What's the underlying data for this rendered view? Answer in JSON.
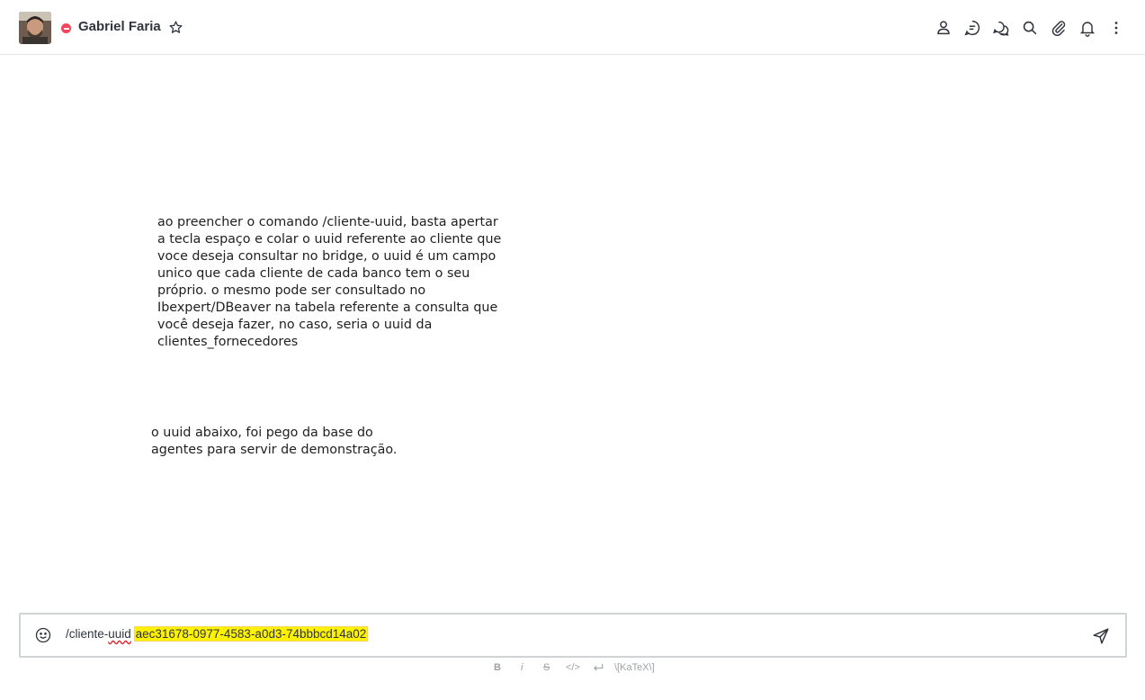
{
  "header": {
    "user_name": "Gabriel Faria",
    "status_color": "#f5455c",
    "toolbar_icons": [
      "user-icon",
      "discussion-icon",
      "threads-icon",
      "search-icon",
      "attachment-icon",
      "notification-bell-icon",
      "kebab-menu-icon"
    ]
  },
  "messages": [
    {
      "text": "ao preencher o comando  /cliente-uuid, basta apertar\na tecla espaço e colar o uuid referente ao cliente que\nvoce deseja consultar no bridge, o uuid é um campo\nunico que cada cliente de cada banco tem o seu\npróprio. o mesmo pode ser consultado no\nIbexpert/DBeaver na tabela referente a consulta que\nvocê deseja fazer, no caso, seria o uuid da\nclientes_fornecedores"
    },
    {
      "text": "o uuid abaixo, foi pego da base do\nagentes para servir de demonstração."
    }
  ],
  "composer": {
    "command_prefix": "/cliente-",
    "command_misspelled": "uuid",
    "uuid_value": "aec31678-0977-4583-a0d3-74bbbcd14a02",
    "highlight_color": "#fff200"
  },
  "formatting_toolbar": {
    "bold": "B",
    "italic": "i",
    "strike": "S",
    "code": "</>",
    "katex": "\\[KaTeX\\]"
  }
}
